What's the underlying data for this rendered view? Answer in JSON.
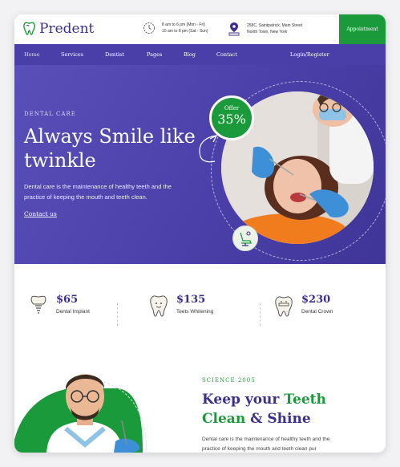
{
  "header": {
    "brand": "Predent",
    "hours_line1": "8 am to 6 pm (Mon - Fri)",
    "hours_line2": "10 am to 8 pm (Sat - Sun)",
    "address_line1": "258C, Saintpatrick, Main Street",
    "address_line2": "Norith Town, New York",
    "appointment_label": "Appointment"
  },
  "nav": {
    "items": [
      "Home",
      "Services",
      "Dentist",
      "Pages",
      "Blog",
      "Contact"
    ],
    "login": "Login/Register"
  },
  "hero": {
    "tag": "DENTAL CARE",
    "title": "Always Smile like twinkle",
    "description": "Dental care is the maintenance of healthy teeth and the practice of keeping the mouth and teeth clean.",
    "link": "Contact us",
    "offer_label": "Offer",
    "offer_value": "35%"
  },
  "services": [
    {
      "price": "$65",
      "name": "Dental Implant",
      "icon": "implant-icon"
    },
    {
      "price": "$135",
      "name": "Teets Whitening",
      "icon": "tooth-whitening-icon"
    },
    {
      "price": "$230",
      "name": "Dental Crown",
      "icon": "dental-crown-icon"
    }
  ],
  "about": {
    "tag": "SCIENCE 2005",
    "title_part1": "Keep your ",
    "title_part2": "Teeth",
    "title_part3": "Clean",
    "title_part4": " & ",
    "title_part5": "Shine",
    "description": "Dental care is the maintenance of healthy teeth and the practice of keeping the mouth and teeth clean pur"
  },
  "colors": {
    "primary": "#4a3fa8",
    "accent": "#1a9a3a",
    "brand_text": "#3b2f8f"
  }
}
